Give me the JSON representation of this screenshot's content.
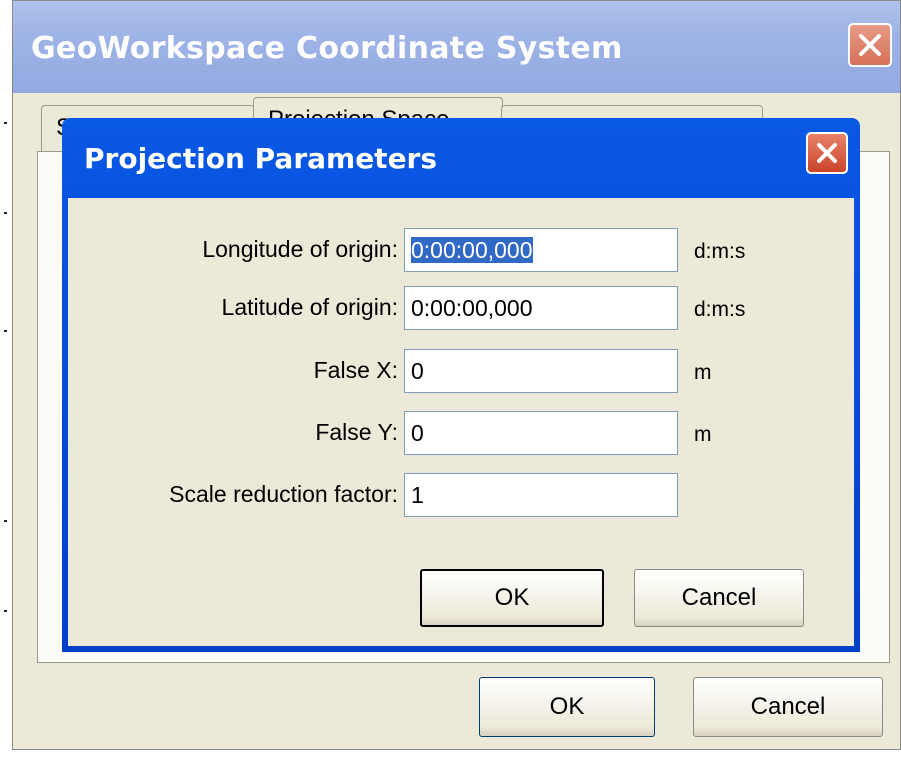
{
  "outer_dialog": {
    "title": "GeoWorkspace Coordinate System",
    "tabs": [
      {
        "label": "S"
      },
      {
        "label": "Projection Space"
      },
      {
        "label": ""
      }
    ],
    "ok_label": "OK",
    "cancel_label": "Cancel"
  },
  "inner_dialog": {
    "title": "Projection Parameters",
    "fields": [
      {
        "label": "Longitude of origin:",
        "value": "0:00:00,000",
        "unit": "d:m:s"
      },
      {
        "label": "Latitude of origin:",
        "value": "0:00:00,000",
        "unit": "d:m:s"
      },
      {
        "label": "False X:",
        "value": "0",
        "unit": "m"
      },
      {
        "label": "False Y:",
        "value": "0",
        "unit": "m"
      },
      {
        "label": "Scale reduction factor:",
        "value": "1",
        "unit": ""
      }
    ],
    "ok_label": "OK",
    "cancel_label": "Cancel"
  },
  "icons": {
    "close": "close-icon"
  },
  "colors": {
    "inner_title_bar": "#0a58e6",
    "outer_title_bar": "#9eb3e6",
    "close_button": "#d67058",
    "dialog_face": "#ece9d8",
    "selection": "#316ac5"
  }
}
